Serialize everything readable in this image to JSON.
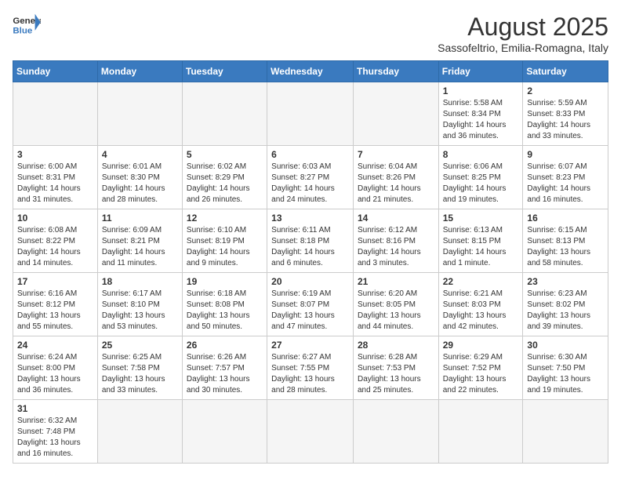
{
  "header": {
    "logo_general": "General",
    "logo_blue": "Blue",
    "month_title": "August 2025",
    "subtitle": "Sassofeltrio, Emilia-Romagna, Italy"
  },
  "weekdays": [
    "Sunday",
    "Monday",
    "Tuesday",
    "Wednesday",
    "Thursday",
    "Friday",
    "Saturday"
  ],
  "weeks": [
    [
      {
        "day": "",
        "info": ""
      },
      {
        "day": "",
        "info": ""
      },
      {
        "day": "",
        "info": ""
      },
      {
        "day": "",
        "info": ""
      },
      {
        "day": "",
        "info": ""
      },
      {
        "day": "1",
        "info": "Sunrise: 5:58 AM\nSunset: 8:34 PM\nDaylight: 14 hours and 36 minutes."
      },
      {
        "day": "2",
        "info": "Sunrise: 5:59 AM\nSunset: 8:33 PM\nDaylight: 14 hours and 33 minutes."
      }
    ],
    [
      {
        "day": "3",
        "info": "Sunrise: 6:00 AM\nSunset: 8:31 PM\nDaylight: 14 hours and 31 minutes."
      },
      {
        "day": "4",
        "info": "Sunrise: 6:01 AM\nSunset: 8:30 PM\nDaylight: 14 hours and 28 minutes."
      },
      {
        "day": "5",
        "info": "Sunrise: 6:02 AM\nSunset: 8:29 PM\nDaylight: 14 hours and 26 minutes."
      },
      {
        "day": "6",
        "info": "Sunrise: 6:03 AM\nSunset: 8:27 PM\nDaylight: 14 hours and 24 minutes."
      },
      {
        "day": "7",
        "info": "Sunrise: 6:04 AM\nSunset: 8:26 PM\nDaylight: 14 hours and 21 minutes."
      },
      {
        "day": "8",
        "info": "Sunrise: 6:06 AM\nSunset: 8:25 PM\nDaylight: 14 hours and 19 minutes."
      },
      {
        "day": "9",
        "info": "Sunrise: 6:07 AM\nSunset: 8:23 PM\nDaylight: 14 hours and 16 minutes."
      }
    ],
    [
      {
        "day": "10",
        "info": "Sunrise: 6:08 AM\nSunset: 8:22 PM\nDaylight: 14 hours and 14 minutes."
      },
      {
        "day": "11",
        "info": "Sunrise: 6:09 AM\nSunset: 8:21 PM\nDaylight: 14 hours and 11 minutes."
      },
      {
        "day": "12",
        "info": "Sunrise: 6:10 AM\nSunset: 8:19 PM\nDaylight: 14 hours and 9 minutes."
      },
      {
        "day": "13",
        "info": "Sunrise: 6:11 AM\nSunset: 8:18 PM\nDaylight: 14 hours and 6 minutes."
      },
      {
        "day": "14",
        "info": "Sunrise: 6:12 AM\nSunset: 8:16 PM\nDaylight: 14 hours and 3 minutes."
      },
      {
        "day": "15",
        "info": "Sunrise: 6:13 AM\nSunset: 8:15 PM\nDaylight: 14 hours and 1 minute."
      },
      {
        "day": "16",
        "info": "Sunrise: 6:15 AM\nSunset: 8:13 PM\nDaylight: 13 hours and 58 minutes."
      }
    ],
    [
      {
        "day": "17",
        "info": "Sunrise: 6:16 AM\nSunset: 8:12 PM\nDaylight: 13 hours and 55 minutes."
      },
      {
        "day": "18",
        "info": "Sunrise: 6:17 AM\nSunset: 8:10 PM\nDaylight: 13 hours and 53 minutes."
      },
      {
        "day": "19",
        "info": "Sunrise: 6:18 AM\nSunset: 8:08 PM\nDaylight: 13 hours and 50 minutes."
      },
      {
        "day": "20",
        "info": "Sunrise: 6:19 AM\nSunset: 8:07 PM\nDaylight: 13 hours and 47 minutes."
      },
      {
        "day": "21",
        "info": "Sunrise: 6:20 AM\nSunset: 8:05 PM\nDaylight: 13 hours and 44 minutes."
      },
      {
        "day": "22",
        "info": "Sunrise: 6:21 AM\nSunset: 8:03 PM\nDaylight: 13 hours and 42 minutes."
      },
      {
        "day": "23",
        "info": "Sunrise: 6:23 AM\nSunset: 8:02 PM\nDaylight: 13 hours and 39 minutes."
      }
    ],
    [
      {
        "day": "24",
        "info": "Sunrise: 6:24 AM\nSunset: 8:00 PM\nDaylight: 13 hours and 36 minutes."
      },
      {
        "day": "25",
        "info": "Sunrise: 6:25 AM\nSunset: 7:58 PM\nDaylight: 13 hours and 33 minutes."
      },
      {
        "day": "26",
        "info": "Sunrise: 6:26 AM\nSunset: 7:57 PM\nDaylight: 13 hours and 30 minutes."
      },
      {
        "day": "27",
        "info": "Sunrise: 6:27 AM\nSunset: 7:55 PM\nDaylight: 13 hours and 28 minutes."
      },
      {
        "day": "28",
        "info": "Sunrise: 6:28 AM\nSunset: 7:53 PM\nDaylight: 13 hours and 25 minutes."
      },
      {
        "day": "29",
        "info": "Sunrise: 6:29 AM\nSunset: 7:52 PM\nDaylight: 13 hours and 22 minutes."
      },
      {
        "day": "30",
        "info": "Sunrise: 6:30 AM\nSunset: 7:50 PM\nDaylight: 13 hours and 19 minutes."
      }
    ],
    [
      {
        "day": "31",
        "info": "Sunrise: 6:32 AM\nSunset: 7:48 PM\nDaylight: 13 hours and 16 minutes."
      },
      {
        "day": "",
        "info": ""
      },
      {
        "day": "",
        "info": ""
      },
      {
        "day": "",
        "info": ""
      },
      {
        "day": "",
        "info": ""
      },
      {
        "day": "",
        "info": ""
      },
      {
        "day": "",
        "info": ""
      }
    ]
  ]
}
